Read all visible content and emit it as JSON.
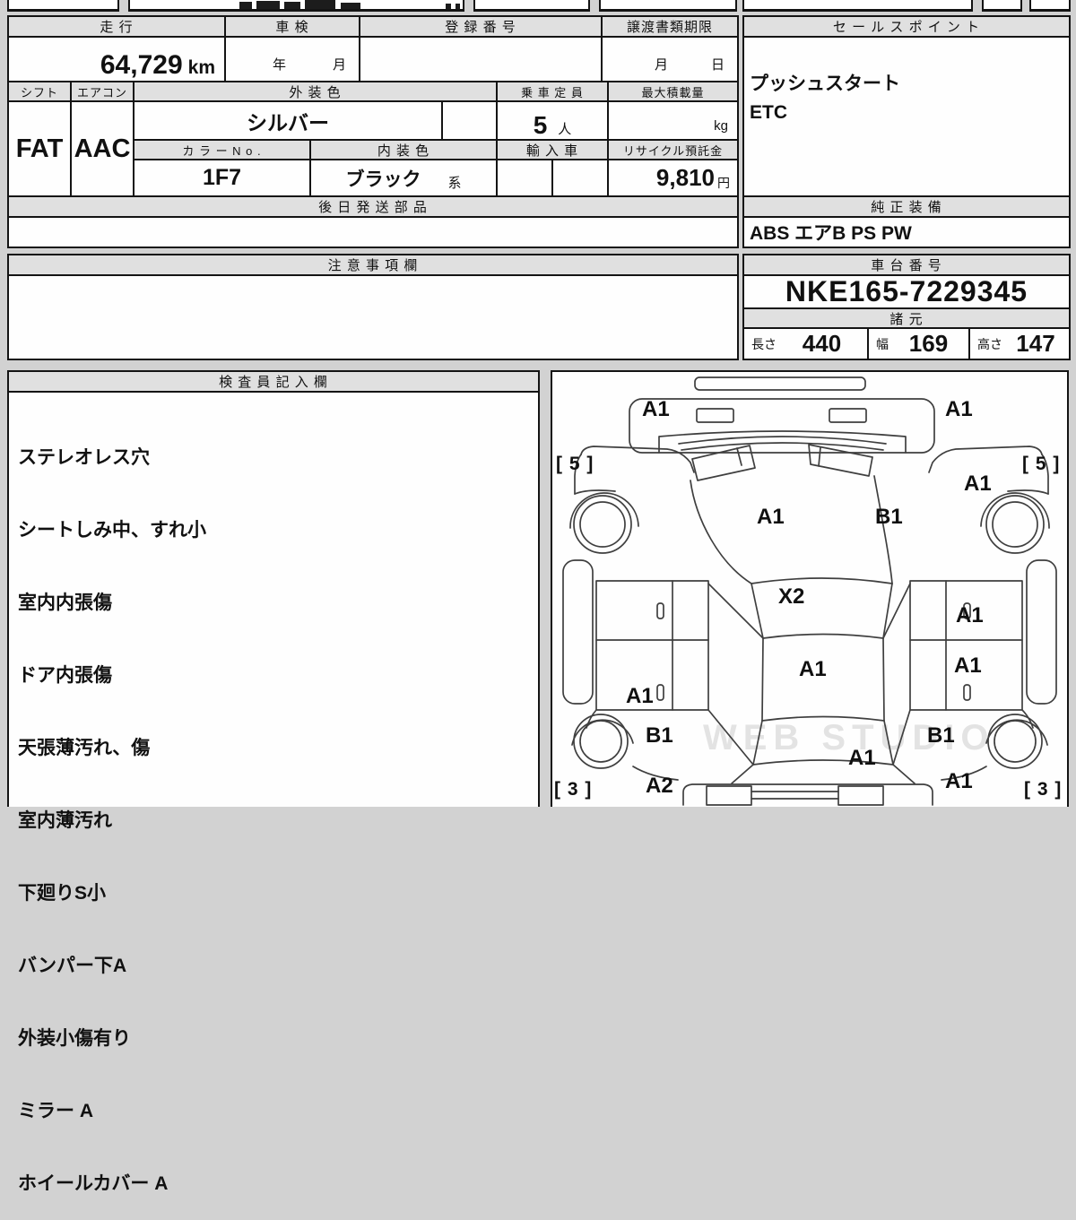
{
  "top_table": {
    "mileage_label": "走 行",
    "mileage_value": "64,729",
    "mileage_unit": "km",
    "inspection_label": "車 検",
    "inspection_year": "年",
    "inspection_month": "月",
    "registration_label": "登 録 番 号",
    "deadline_label": "譲渡書類期限",
    "deadline_month": "月",
    "deadline_day": "日",
    "shift_label": "シフト",
    "shift_value": "FAT",
    "aircon_label": "エアコン",
    "aircon_value": "AAC",
    "exterior_label": "外 装 色",
    "exterior_value": "シルバー",
    "capacity_label": "乗 車 定 員",
    "capacity_value": "5",
    "capacity_unit": "人",
    "load_label": "最大積載量",
    "load_unit": "kg",
    "colorno_label": "カ ラ ー N o .",
    "colorno_value": "1F7",
    "interior_label": "内 装 色",
    "interior_value": "ブラック",
    "interior_suffix": "系",
    "import_label": "輸 入 車",
    "recycle_label": "リサイクル預託金",
    "recycle_value": "9,810",
    "recycle_unit": "円",
    "later_parts_label": "後 日 発 送 部 品"
  },
  "sales": {
    "label": "セ ー ル ス ポ イ ン ト",
    "line1": "プッシュスタート",
    "line2": "ETC"
  },
  "equipment": {
    "label": "純 正 装 備",
    "value": "ABS エアB PS PW"
  },
  "caution": {
    "label": "注 意 事 項 欄"
  },
  "chassis": {
    "label": "車 台 番 号",
    "value": "NKE165-7229345"
  },
  "specs": {
    "label": "諸 元",
    "length_label": "長さ",
    "length_value": "440",
    "width_label": "幅",
    "width_value": "169",
    "height_label": "高さ",
    "height_value": "147"
  },
  "inspector": {
    "label": "検 査 員 記 入 欄",
    "lines": [
      "ステレオレス穴",
      "シートしみ中、すれ小",
      "室内内張傷",
      "ドア内張傷",
      "天張薄汚れ、傷",
      "室内薄汚れ",
      "下廻りS小",
      "バンパー下A",
      "外装小傷有り",
      "ミラー A",
      "ホイールカバー A"
    ]
  },
  "diagram": {
    "watermark": "WEB STUDIO",
    "marks": [
      {
        "label": "A1"
      },
      {
        "label": "A1"
      },
      {
        "label": "[ 5 ]"
      },
      {
        "label": "[ 5 ]"
      },
      {
        "label": "A1"
      },
      {
        "label": "A1"
      },
      {
        "label": "B1"
      },
      {
        "label": "X2"
      },
      {
        "label": "A1"
      },
      {
        "label": "A1"
      },
      {
        "label": "A1"
      },
      {
        "label": "A1"
      },
      {
        "label": "B1"
      },
      {
        "label": "B1"
      },
      {
        "label": "A1"
      },
      {
        "label": "A2"
      },
      {
        "label": "A1"
      },
      {
        "label": "[ 3 ]"
      },
      {
        "label": "[ 3 ]"
      }
    ]
  }
}
